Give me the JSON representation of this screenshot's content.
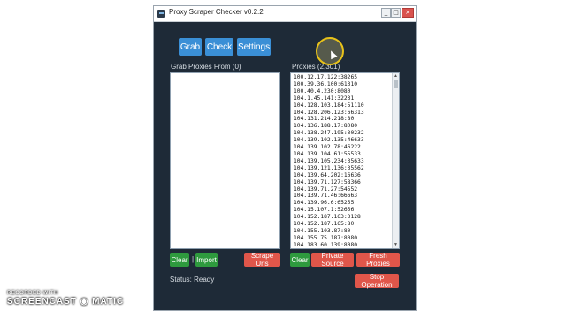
{
  "window": {
    "title": "Proxy Scraper Checker v0.2.2",
    "controls": [
      "_",
      "□",
      "×"
    ]
  },
  "toolbar": {
    "grab": "Grab",
    "check": "Check",
    "settings": "Settings"
  },
  "left_panel": {
    "heading": "Grab Proxies From (0)"
  },
  "right_panel": {
    "heading": "Proxies (2,301)",
    "proxies": [
      "100.12.17.122:38265",
      "100.39.36.100:61310",
      "100.40.4.230:8080",
      "104.1.45.141:32231",
      "104.128.103.184:51110",
      "104.128.206.123:66313",
      "104.131.214.218:80",
      "104.136.188.17:8080",
      "104.138.247.195:30232",
      "104.139.102.135:46633",
      "104.139.102.78:46222",
      "104.139.104.61:55533",
      "104.139.105.234:35633",
      "104.139.121.136:35562",
      "104.139.64.202:16636",
      "104.139.71.127:58366",
      "104.139.71.27:54552",
      "104.139.71.46:66663",
      "104.139.96.6:65255",
      "104.15.107.1:52656",
      "104.152.187.163:3128",
      "104.152.187.165:80",
      "104.155.103.87:80",
      "104.155.75.187:8080",
      "104.183.60.139:8080"
    ]
  },
  "left_actions": {
    "clear": "Clear",
    "separator": "|",
    "import": "Import",
    "scrape_urls": "Scrape Urls"
  },
  "right_actions": {
    "clear": "Clear",
    "private_source": "Private Source",
    "fresh_proxies": "Fresh Proxies"
  },
  "status": {
    "text": "Status: Ready"
  },
  "stop_operation": "Stop Operation",
  "recorder": {
    "line1": "RECORDED WITH",
    "line2": "SCREENCAST ◉ MATIC"
  },
  "colors": {
    "window_bg": "#1e2a37",
    "accent_blue": "#3a8fd6",
    "accent_green": "#2e9a3e",
    "accent_red": "#e0564a"
  }
}
